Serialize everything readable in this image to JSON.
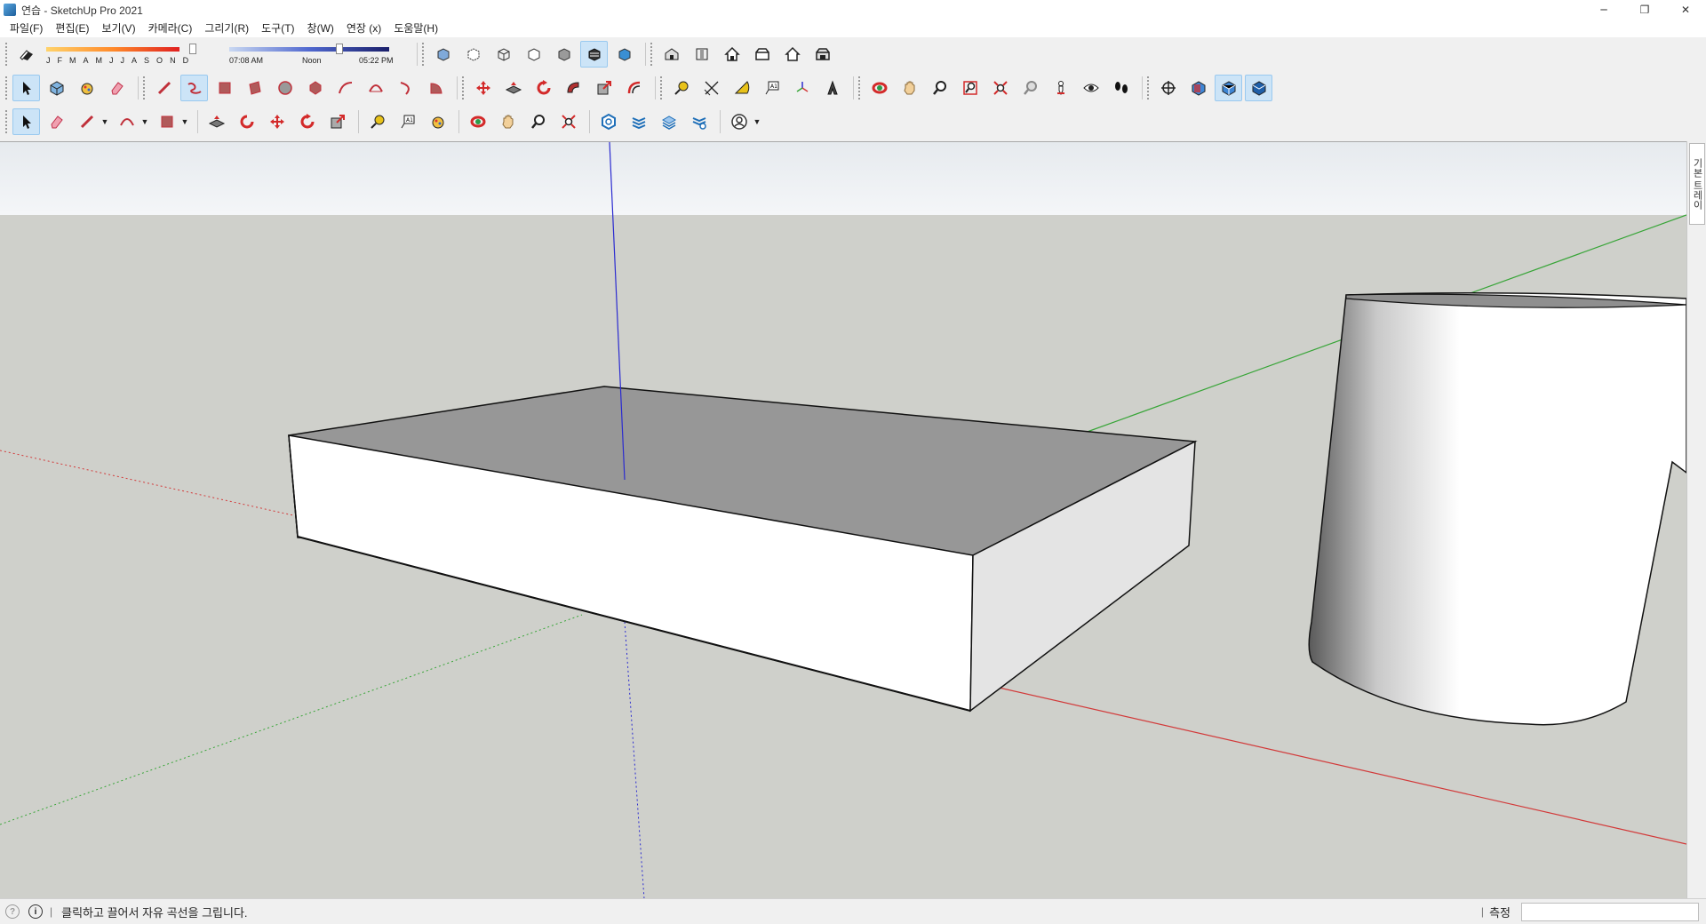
{
  "window": {
    "title": "연습 - SketchUp Pro 2021",
    "minimize": "─",
    "maximize": "❐",
    "close": "✕"
  },
  "menu": [
    "파일(F)",
    "편집(E)",
    "보기(V)",
    "카메라(C)",
    "그리기(R)",
    "도구(T)",
    "창(W)",
    "연장 (x)",
    "도움말(H)"
  ],
  "shadows": {
    "months": [
      "J",
      "F",
      "M",
      "A",
      "M",
      "J",
      "J",
      "A",
      "S",
      "O",
      "N",
      "D"
    ],
    "sunrise": "07:08 AM",
    "noon": "Noon",
    "sunset": "05:22 PM"
  },
  "toolbar_row1": [
    "shadows-toggle-icon",
    "xray-icon",
    "back-edges-icon",
    "wireframe-icon",
    "hidden-line-icon",
    "shaded-icon",
    "shaded-textures-icon",
    "monochrome-icon",
    "iso-view-icon",
    "top-view-icon",
    "front-view-icon",
    "right-view-icon",
    "back-view-icon",
    "left-view-icon"
  ],
  "toolbar_row2": [
    "select-icon",
    "make-component-icon",
    "paint-bucket-icon",
    "eraser-icon",
    "line-icon",
    "freehand-icon",
    "rectangle-icon",
    "rotated-rectangle-icon",
    "circle-icon",
    "polygon-icon",
    "arc-icon",
    "two-point-arc-icon",
    "three-point-arc-icon",
    "pie-icon",
    "move-icon",
    "push-pull-icon",
    "rotate-icon",
    "follow-me-icon",
    "scale-icon",
    "offset-icon",
    "tape-measure-icon",
    "dimension-icon",
    "protractor-icon",
    "text-icon",
    "axes-icon",
    "3d-text-icon",
    "orbit-icon",
    "pan-icon",
    "zoom-icon",
    "zoom-window-icon",
    "zoom-extents-icon",
    "previous-view-icon",
    "position-camera-icon",
    "look-around-icon",
    "walk-icon",
    "section-plane-icon",
    "display-section-planes-icon",
    "display-section-cuts-icon",
    "display-section-fill-icon"
  ],
  "toolbar_row3": [
    "select-icon",
    "eraser-icon",
    "line-icon",
    "arc-icon",
    "shape-icon",
    "push-pull-icon",
    "follow-me-icon",
    "move-icon",
    "rotate-icon",
    "scale-icon",
    "tape-measure-icon",
    "text-icon",
    "paint-bucket-icon",
    "orbit-icon",
    "pan-icon",
    "zoom-icon",
    "zoom-extents-icon",
    "3d-warehouse-icon",
    "extension-warehouse-icon",
    "layout-icon",
    "extension-manager-icon",
    "account-icon"
  ],
  "tray": {
    "tab_label": "기본 트레이"
  },
  "status": {
    "message": "클릭하고 끌어서 자유 곡선을 그립니다.",
    "measure_label": "측정",
    "measure_value": ""
  },
  "colors": {
    "viewport_bg": "#cfd0cb",
    "sky": "#e2e6ea",
    "axis_red": "#d23a3a",
    "axis_green": "#38a538",
    "axis_blue": "#2b2bd0",
    "box_top": "#979797",
    "box_side": "#ffffff"
  }
}
